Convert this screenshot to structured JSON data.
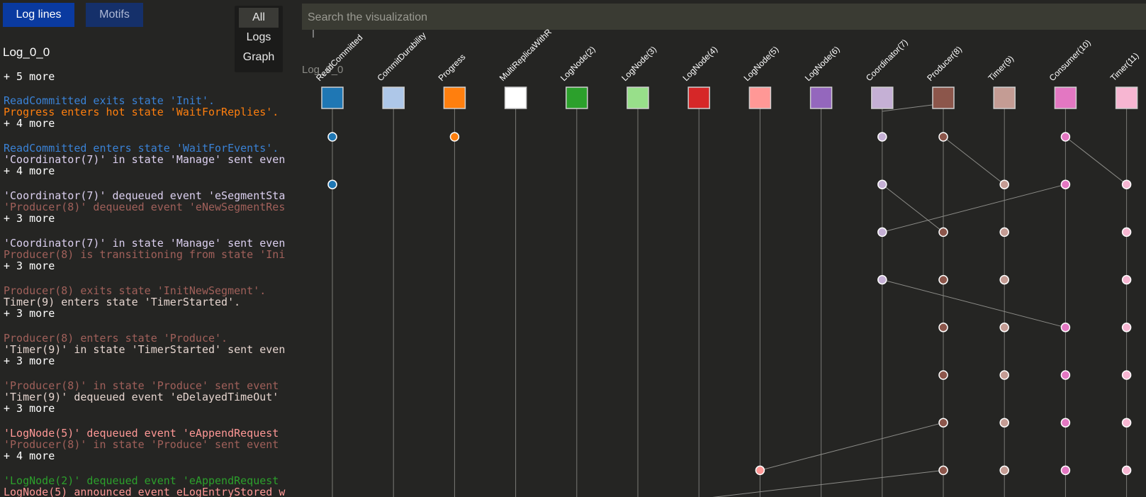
{
  "tabs": {
    "log_lines": "Log lines",
    "motifs": "Motifs"
  },
  "view_menu": {
    "options": [
      "All",
      "Logs",
      "Graph"
    ],
    "selected": "All"
  },
  "search": {
    "placeholder": "Search the visualization"
  },
  "log": {
    "title": "Log_0_0",
    "more_label": "+ 5 more",
    "groups": [
      {
        "lines": [
          {
            "text": "ReadCommitted exits state 'Init'.",
            "color": "#3a82d6"
          },
          {
            "text": "Progress enters hot state 'WaitForReplies'.",
            "color": "#ff7f0e"
          }
        ],
        "more": "+ 4 more"
      },
      {
        "lines": [
          {
            "text": "ReadCommitted enters state 'WaitForEvents'.",
            "color": "#3a82d6"
          },
          {
            "text": "'Coordinator(7)' in state 'Manage' sent even",
            "color": "#dcd0f0"
          }
        ],
        "more": "+ 4 more"
      },
      {
        "lines": [
          {
            "text": "'Coordinator(7)' dequeued event 'eSegmentSta",
            "color": "#dcd0f0"
          },
          {
            "text": "'Producer(8)' dequeued event 'eNewSegmentRes",
            "color": "#a0605a"
          }
        ],
        "more": "+ 3 more"
      },
      {
        "lines": [
          {
            "text": "'Coordinator(7)' in state 'Manage' sent even",
            "color": "#dcd0f0"
          },
          {
            "text": "Producer(8) is transitioning from state 'Ini",
            "color": "#a0605a"
          }
        ],
        "more": "+ 3 more"
      },
      {
        "lines": [
          {
            "text": "Producer(8) exits state 'InitNewSegment'.",
            "color": "#a0605a"
          },
          {
            "text": "Timer(9) enters state 'TimerStarted'.",
            "color": "#e6d5cf"
          }
        ],
        "more": "+ 3 more"
      },
      {
        "lines": [
          {
            "text": "Producer(8) enters state 'Produce'.",
            "color": "#a0605a"
          },
          {
            "text": "'Timer(9)' in state 'TimerStarted' sent even",
            "color": "#e6d5cf"
          }
        ],
        "more": "+ 3 more"
      },
      {
        "lines": [
          {
            "text": "'Producer(8)' in state 'Produce' sent event",
            "color": "#a0605a"
          },
          {
            "text": "'Timer(9)' dequeued event 'eDelayedTimeOut'",
            "color": "#e6d5cf"
          }
        ],
        "more": "+ 3 more"
      },
      {
        "lines": [
          {
            "text": "'LogNode(5)' dequeued event 'eAppendRequest",
            "color": "#ff9896"
          },
          {
            "text": "'Producer(8)' in state 'Produce' sent event",
            "color": "#a0605a"
          }
        ],
        "more": "+ 4 more"
      },
      {
        "lines": [
          {
            "text": "'LogNode(2)' dequeued event 'eAppendRequest",
            "color": "#2ca02c"
          },
          {
            "text": "LogNode(5) announced event eLogEntryStored w",
            "color": "#ff9896"
          }
        ],
        "more": ""
      }
    ]
  },
  "graph": {
    "subtitle": "Log_0_0",
    "lifelines": [
      {
        "name": "ReadCommitted",
        "color": "#1f77b4"
      },
      {
        "name": "CommitDurability",
        "color": "#aec7e8"
      },
      {
        "name": "Progress",
        "color": "#ff7f0e"
      },
      {
        "name": "MultiReplicaWithR",
        "color": "#ffffff"
      },
      {
        "name": "LogNode(2)",
        "color": "#2ca02c"
      },
      {
        "name": "LogNode(3)",
        "color": "#98df8a"
      },
      {
        "name": "LogNode(4)",
        "color": "#d62728"
      },
      {
        "name": "LogNode(5)",
        "color": "#ff9896"
      },
      {
        "name": "LogNode(6)",
        "color": "#9467bd"
      },
      {
        "name": "Coordinator(7)",
        "color": "#c5b0d5"
      },
      {
        "name": "Producer(8)",
        "color": "#8c564b"
      },
      {
        "name": "Timer(9)",
        "color": "#c49c94"
      },
      {
        "name": "Consumer(10)",
        "color": "#e377c2"
      },
      {
        "name": "Timer(11)",
        "color": "#f7b6d2"
      }
    ],
    "events": [
      {
        "row": 0,
        "dots": [
          0,
          2,
          9,
          10,
          12
        ]
      },
      {
        "row": 1,
        "dots": [
          0,
          9,
          11,
          12,
          13
        ]
      },
      {
        "row": 2,
        "dots": [
          9,
          10,
          11,
          13
        ]
      },
      {
        "row": 3,
        "dots": [
          9,
          10,
          11,
          13
        ]
      },
      {
        "row": 4,
        "dots": [
          10,
          11,
          12,
          13
        ]
      },
      {
        "row": 5,
        "dots": [
          10,
          11,
          12,
          13
        ]
      },
      {
        "row": 6,
        "dots": [
          10,
          11,
          12,
          13
        ]
      },
      {
        "row": 7,
        "dots": [
          7,
          10,
          11,
          12,
          13
        ]
      }
    ],
    "messages": [
      {
        "from": [
          9,
          -1
        ],
        "to": [
          10,
          -0.7
        ]
      },
      {
        "from": [
          10,
          0
        ],
        "to": [
          11,
          1
        ]
      },
      {
        "from": [
          12,
          0
        ],
        "to": [
          13,
          1
        ]
      },
      {
        "from": [
          9,
          1
        ],
        "to": [
          10,
          2
        ]
      },
      {
        "from": [
          12,
          1
        ],
        "to": [
          9,
          2
        ]
      },
      {
        "from": [
          9,
          3
        ],
        "to": [
          12,
          4
        ]
      },
      {
        "from": [
          10,
          6
        ],
        "to": [
          7,
          7
        ]
      },
      {
        "from": [
          10,
          7
        ],
        "to": [
          6,
          7.6
        ]
      }
    ]
  }
}
